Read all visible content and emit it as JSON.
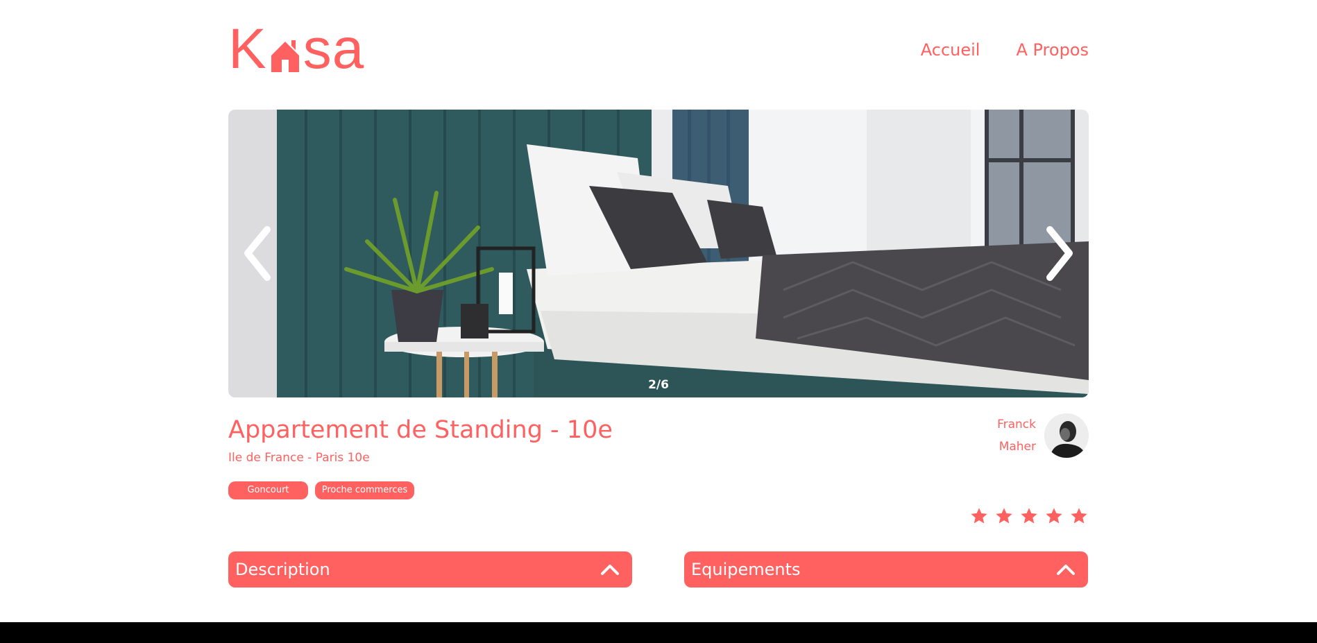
{
  "app": {
    "logo_text_pre": "K",
    "logo_text_post": "sa",
    "brand_color": "#FF6060"
  },
  "nav": {
    "items": [
      {
        "label": "Accueil"
      },
      {
        "label": "A Propos"
      }
    ]
  },
  "gallery": {
    "counter": "2/6",
    "prev_icon": "chevron-left-icon",
    "next_icon": "chevron-right-icon"
  },
  "listing": {
    "title": "Appartement de Standing - 10e",
    "location": "Ile de France - Paris 10e",
    "tags": [
      "Goncourt",
      "Proche commerces"
    ],
    "host": {
      "first_name": "Franck",
      "last_name": "Maher"
    },
    "rating": {
      "value": 5,
      "max": 5,
      "filled_color": "#FF6060"
    }
  },
  "sections": [
    {
      "label": "Description",
      "icon": "chevron-up-icon"
    },
    {
      "label": "Equipements",
      "icon": "chevron-up-icon"
    }
  ]
}
